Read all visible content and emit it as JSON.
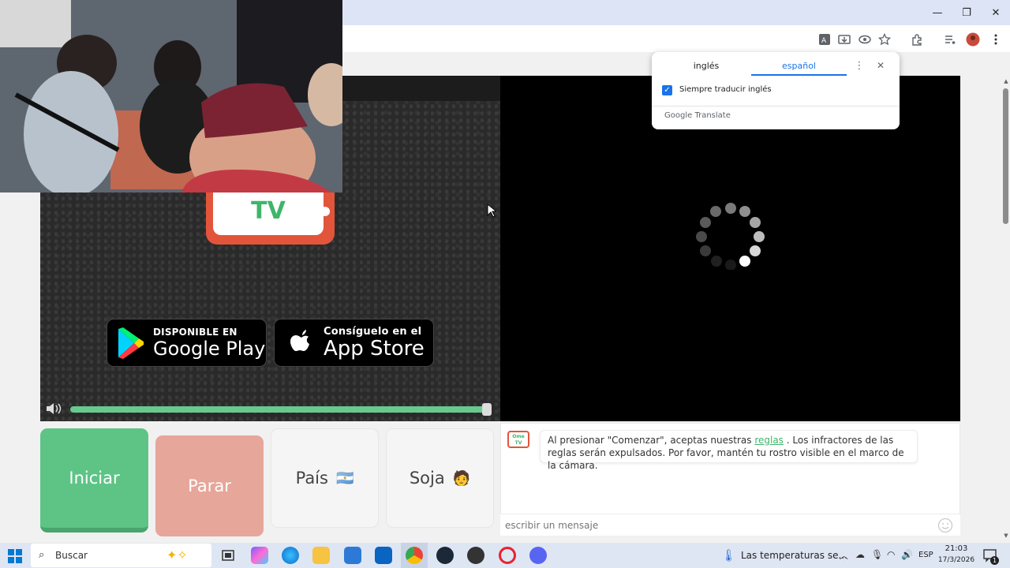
{
  "browser": {
    "window_controls": [
      "—",
      "❐",
      "✕"
    ],
    "toolbar_icons": [
      "translate-icon",
      "install-icon",
      "eye-icon",
      "star-icon",
      "extensions-icon",
      "media-icon",
      "profile-icon",
      "menu-icon"
    ]
  },
  "translate_popup": {
    "tab_source": "inglés",
    "tab_target": "español",
    "checkbox_label": "Siempre traducir inglés",
    "footer_google": "Google",
    "footer_translate": "Translate"
  },
  "local_video": {
    "logo_text": "TV",
    "google_play": {
      "small": "DISPONIBLE EN",
      "big": "Google Play"
    },
    "app_store": {
      "small": "Consíguelo en el",
      "big": "App Store"
    },
    "volume_level": 1.0
  },
  "controls": {
    "start": "Iniciar",
    "stop": "Parar",
    "country": "País",
    "country_flag": "🇦🇷",
    "gender": "Soja",
    "gender_emoji": "🧑"
  },
  "chat": {
    "avatar_text_1": "Ome",
    "avatar_text_2": "TV",
    "message_before": "Al presionar \"Comenzar\", aceptas nuestras",
    "message_link": "reglas",
    "message_after": ". Los infractores de las reglas serán expulsados. Por favor, mantén tu rostro visible en el marco de la cámara.",
    "input_placeholder": "escribir un mensaje"
  },
  "taskbar": {
    "search_placeholder": "Buscar",
    "weather_text": "Las temperaturas se...",
    "language": "ESP",
    "time": "21:03",
    "date": "17/3/2026",
    "notification_count": "1"
  }
}
